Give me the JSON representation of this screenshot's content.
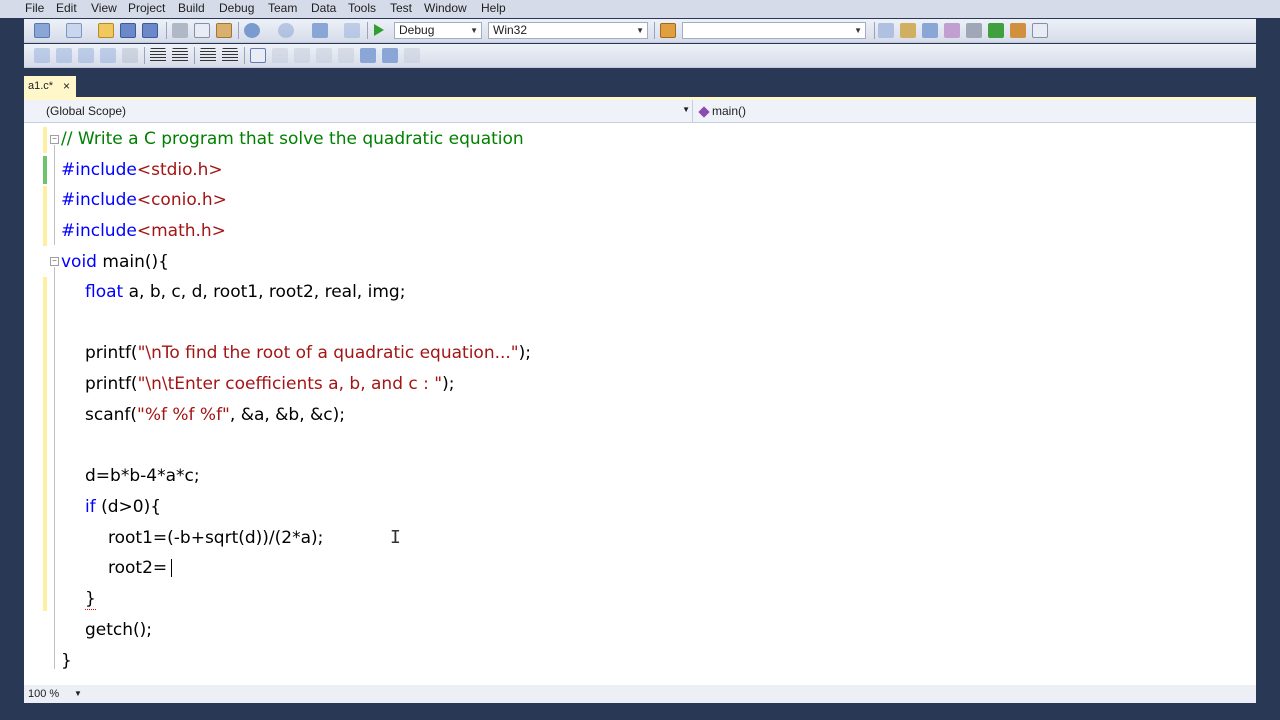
{
  "menu": [
    "File",
    "Edit",
    "View",
    "Project",
    "Build",
    "Debug",
    "Team",
    "Data",
    "Tools",
    "Test",
    "Window",
    "Help"
  ],
  "toolbar": {
    "config_value": "Debug",
    "platform_value": "Win32",
    "find_value": "",
    "start_icon": "play-icon"
  },
  "tab": {
    "title": "a1.c*",
    "close": "×"
  },
  "nav": {
    "scope": "(Global Scope)",
    "member": "main()"
  },
  "code": {
    "l1": "// Write a C program that solve the quadratic equation",
    "l2_kw": "#include",
    "l2_h": "<stdio.h>",
    "l3_kw": "#include",
    "l3_h": "<conio.h>",
    "l4_kw": "#include",
    "l4_h": "<math.h>",
    "l5_kw": "void",
    "l5_rest": " main(){",
    "l6_kw": "float",
    "l6_rest": " a, b, c, d, root1, root2, real, img;",
    "l8_a": "printf(",
    "l8_s": "\"\\nTo find the root of a quadratic equation...\"",
    "l8_b": ");",
    "l9_a": "printf(",
    "l9_s": "\"\\n\\tEnter coefficients a, b, and c : \"",
    "l9_b": ");",
    "l10_a": "scanf(",
    "l10_s": "\"%f %f %f\"",
    "l10_b": ", &a, &b, &c);",
    "l12": "d=b*b-4*a*c;",
    "l13_kw": "if",
    "l13_rest": " (d>0){",
    "l14": "root1=(-b+sqrt(d))/(2*a);",
    "l15": "root2=",
    "l16": "}",
    "l17": "getch();",
    "l18": "}"
  },
  "status": {
    "zoom": "100 %"
  }
}
